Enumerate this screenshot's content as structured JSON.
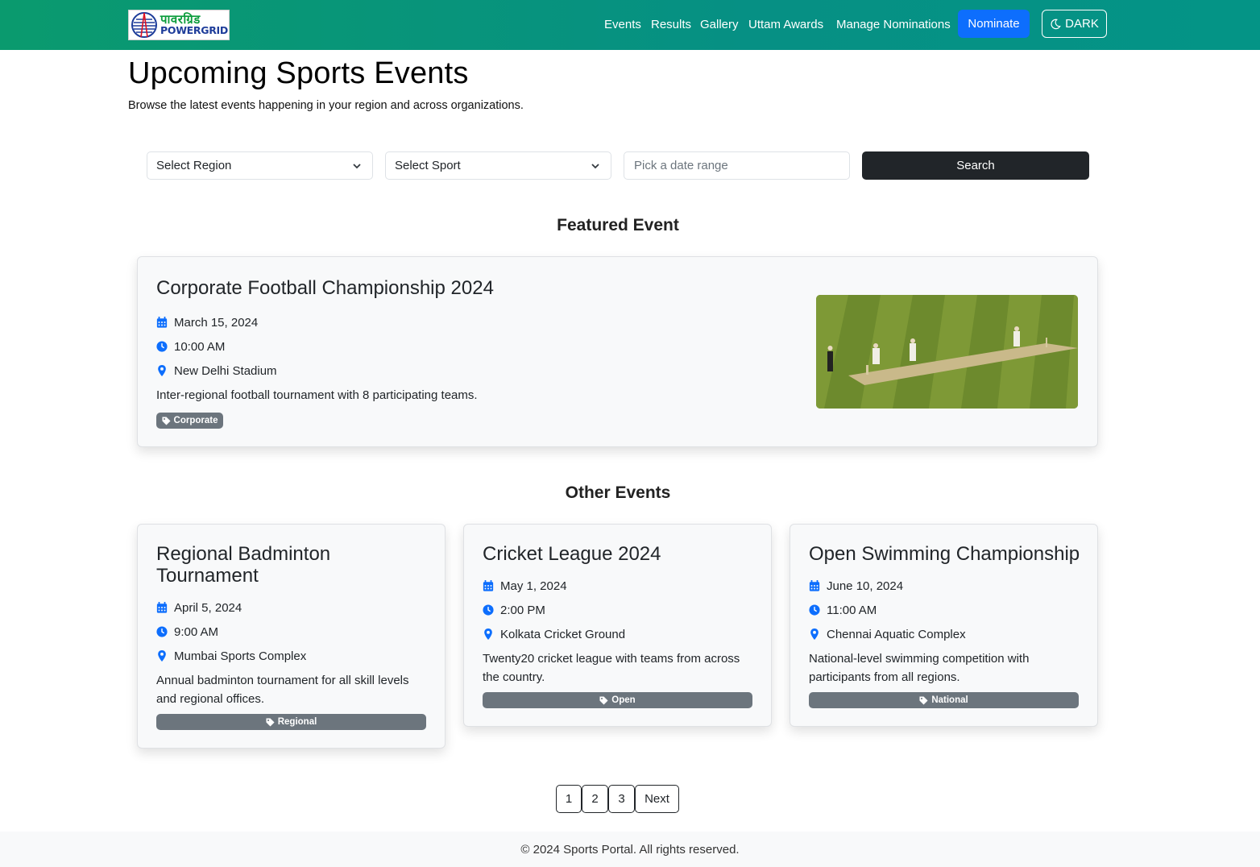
{
  "navbar": {
    "logo": {
      "hindi": "पावरग्रिड",
      "english": "POWERGRID"
    },
    "links": [
      "Events",
      "Results",
      "Gallery",
      "Uttam Awards",
      "Manage Nominations"
    ],
    "nominate_label": "Nominate",
    "theme_label": "DARK",
    "theme_icon": "moon-icon"
  },
  "header": {
    "title": "Upcoming Sports Events",
    "subtitle": "Browse the latest events happening in your region and across organizations."
  },
  "filters": {
    "region_value": "Select Region",
    "sport_value": "Select Sport",
    "date_placeholder": "Pick a date range",
    "search_label": "Search"
  },
  "featured": {
    "section_title": "Featured Event",
    "title": "Corporate Football Championship 2024",
    "date": "March 15, 2024",
    "time": "10:00 AM",
    "location": "New Delhi Stadium",
    "description": "Inter-regional football tournament with 8 participating teams.",
    "badge": "Corporate"
  },
  "other": {
    "section_title": "Other Events",
    "events": [
      {
        "title": "Regional Badminton Tournament",
        "date": "April 5, 2024",
        "time": "9:00 AM",
        "location": "Mumbai Sports Complex",
        "description": "Annual badminton tournament for all skill levels and regional offices.",
        "badge": "Regional"
      },
      {
        "title": "Cricket League 2024",
        "date": "May 1, 2024",
        "time": "2:00 PM",
        "location": "Kolkata Cricket Ground",
        "description": "Twenty20 cricket league with teams from across the country.",
        "badge": "Open"
      },
      {
        "title": "Open Swimming Championship",
        "date": "June 10, 2024",
        "time": "11:00 AM",
        "location": "Chennai Aquatic Complex",
        "description": "National-level swimming competition with participants from all regions.",
        "badge": "National"
      }
    ]
  },
  "pagination": {
    "pages": [
      "1",
      "2",
      "3"
    ],
    "next_label": "Next"
  },
  "footer": {
    "text": "© 2024 Sports Portal. All rights reserved."
  },
  "colors": {
    "nav_gradient_start": "#0a9a6e",
    "nav_gradient_end": "#049486",
    "primary": "#0d6efd",
    "dark": "#212529",
    "badge": "#6c757d"
  }
}
